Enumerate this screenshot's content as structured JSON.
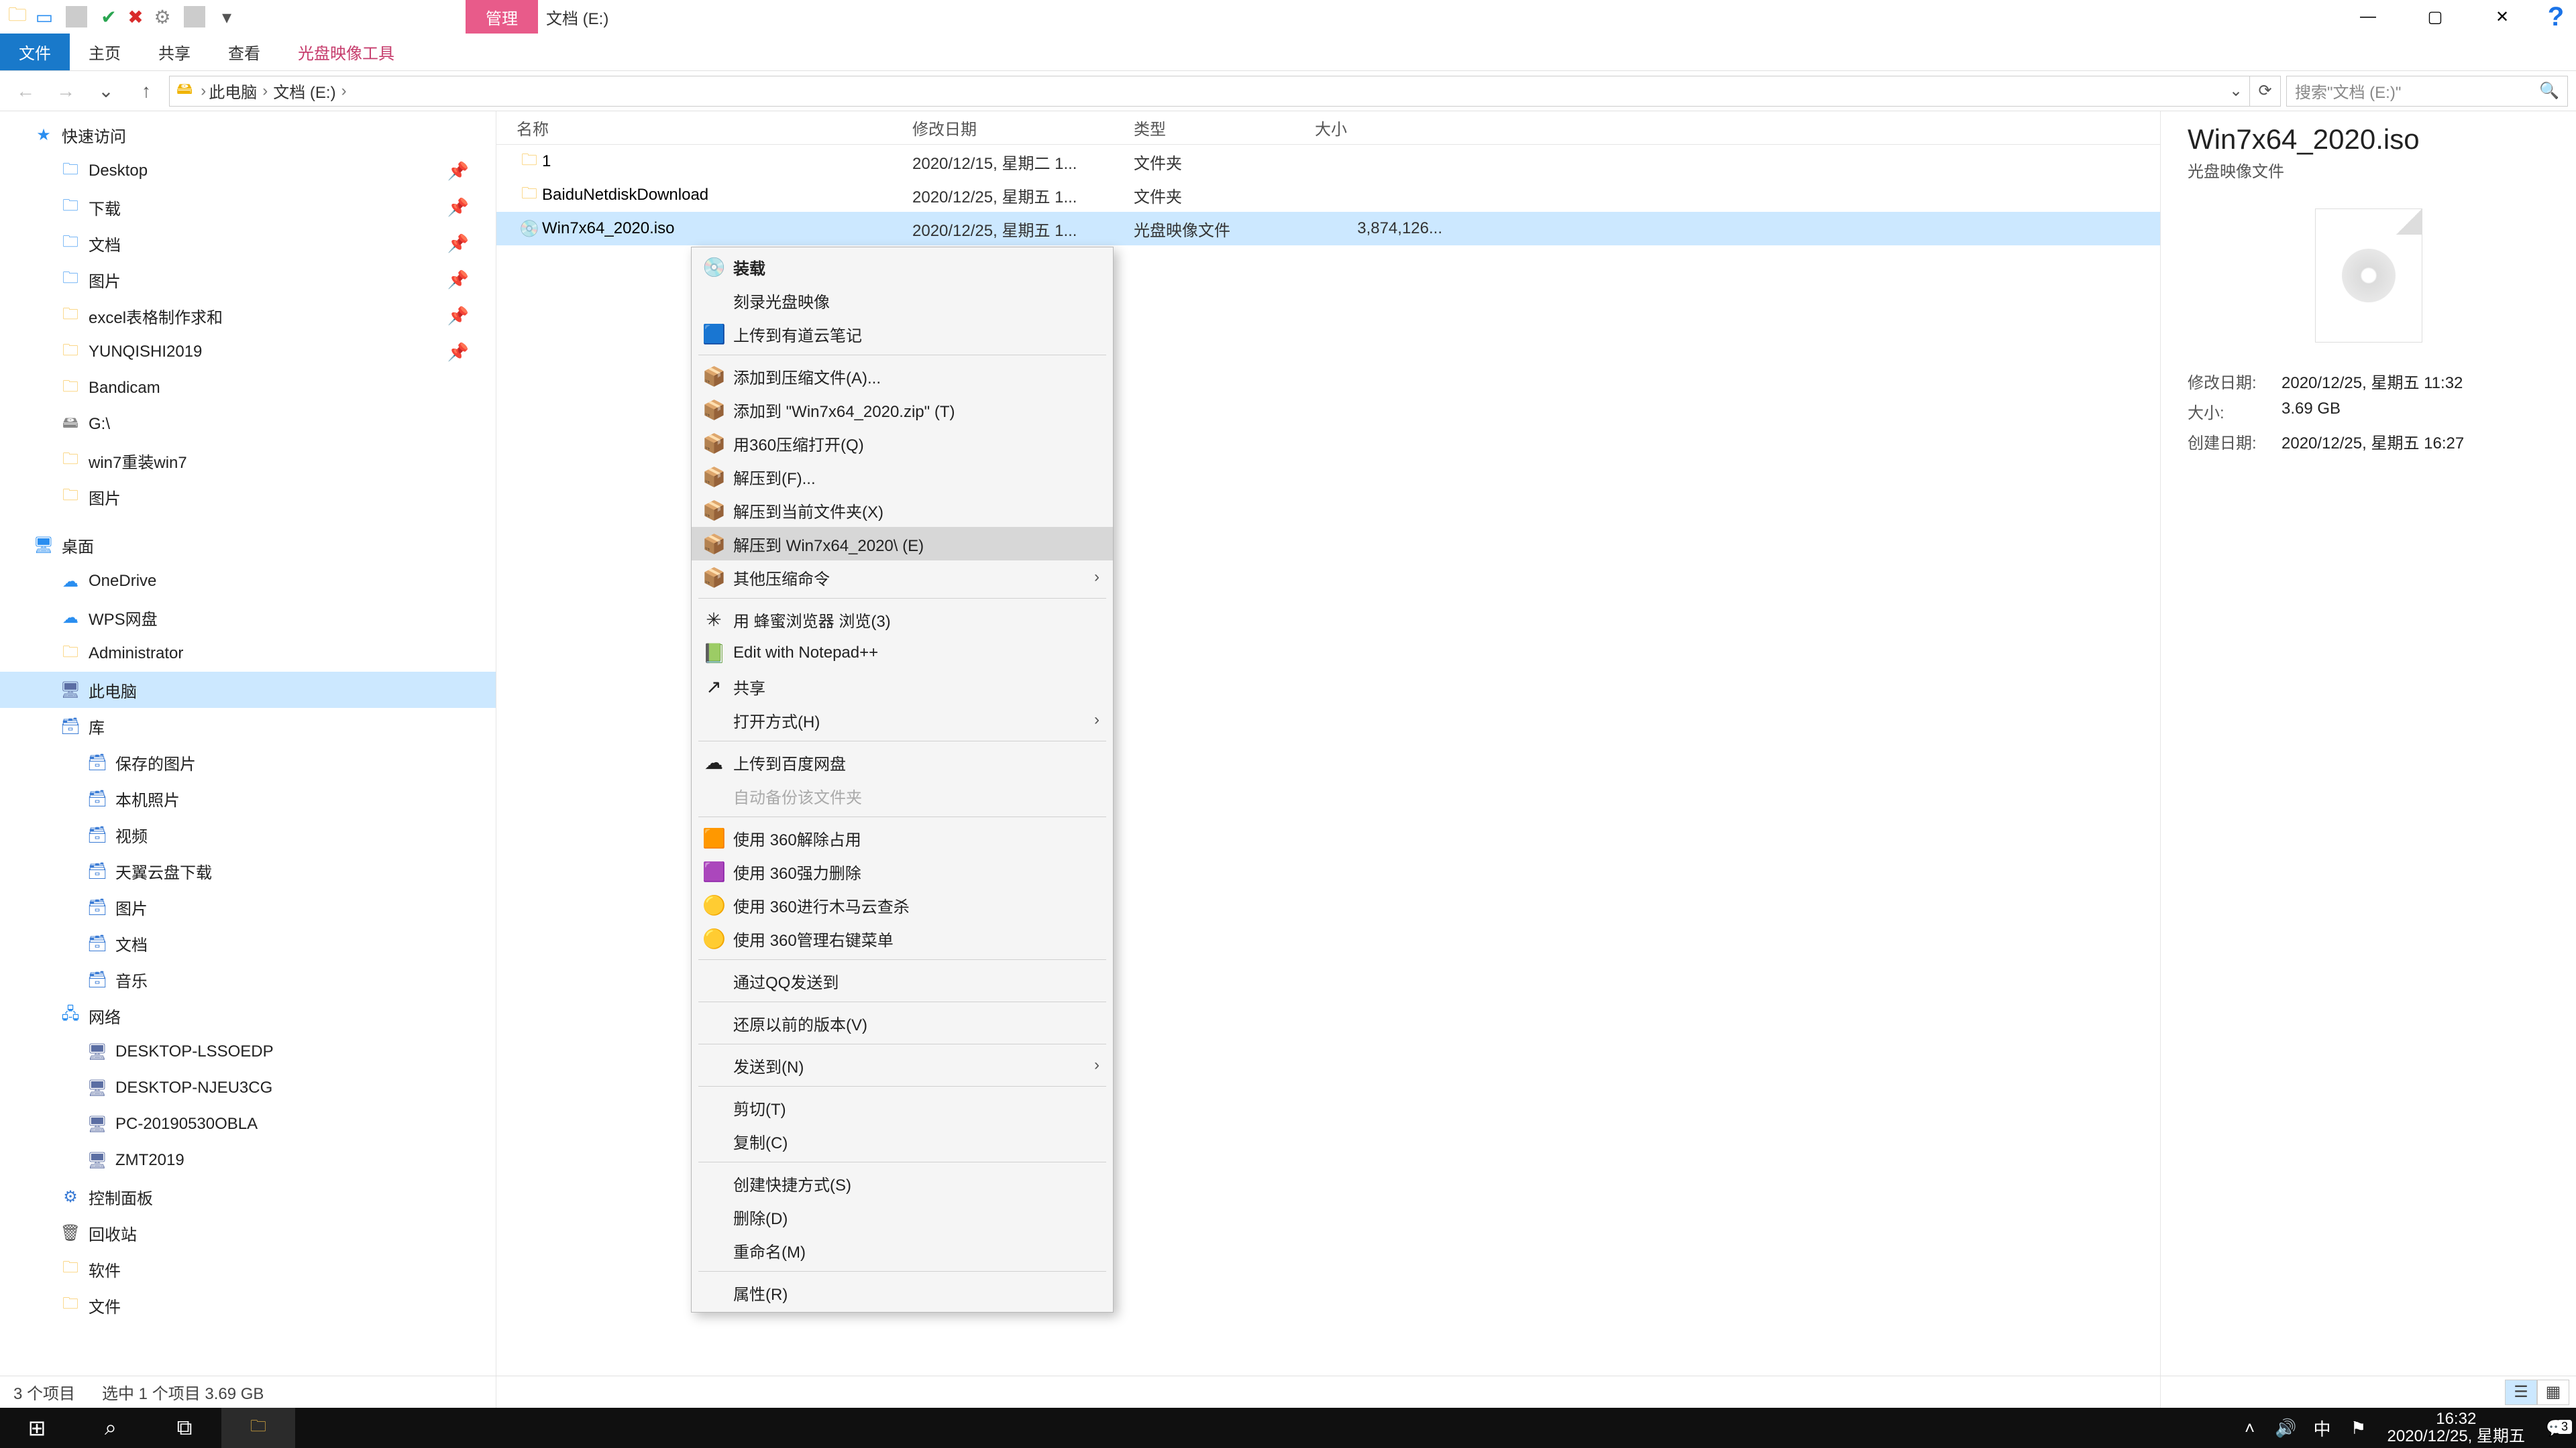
{
  "title": {
    "ribbon_section": "管理",
    "app_caption": "文档 (E:)"
  },
  "ribbon": {
    "file": "文件",
    "home": "主页",
    "share": "共享",
    "view": "查看",
    "disc_tools": "光盘映像工具"
  },
  "nav": {
    "breadcrumbs": [
      "此电脑",
      "文档 (E:)"
    ],
    "search_placeholder": "搜索\"文档 (E:)\""
  },
  "tree": {
    "quick_access": "快速访问",
    "items_qa": [
      {
        "label": "Desktop",
        "icon": "blue"
      },
      {
        "label": "下载",
        "icon": "blue"
      },
      {
        "label": "文档",
        "icon": "blue"
      },
      {
        "label": "图片",
        "icon": "blue"
      },
      {
        "label": "excel表格制作求和",
        "icon": "folder"
      },
      {
        "label": "YUNQISHI2019",
        "icon": "folder"
      },
      {
        "label": "Bandicam",
        "icon": "folder"
      },
      {
        "label": "G:\\",
        "icon": "drive"
      },
      {
        "label": "win7重装win7",
        "icon": "folder"
      },
      {
        "label": "图片",
        "icon": "folder"
      }
    ],
    "desktop": "桌面",
    "items_desktop": [
      {
        "label": "OneDrive",
        "icon": "blue"
      },
      {
        "label": "WPS网盘",
        "icon": "blue"
      },
      {
        "label": "Administrator",
        "icon": "folder"
      },
      {
        "label": "此电脑",
        "icon": "pc",
        "selected": true
      },
      {
        "label": "库",
        "icon": "lib"
      }
    ],
    "items_lib": [
      {
        "label": "保存的图片"
      },
      {
        "label": "本机照片"
      },
      {
        "label": "视频"
      },
      {
        "label": "天翼云盘下载"
      },
      {
        "label": "图片"
      },
      {
        "label": "文档"
      },
      {
        "label": "音乐"
      }
    ],
    "network": "网络",
    "items_net": [
      {
        "label": "DESKTOP-LSSOEDP"
      },
      {
        "label": "DESKTOP-NJEU3CG"
      },
      {
        "label": "PC-20190530OBLA"
      },
      {
        "label": "ZMT2019"
      }
    ],
    "control_panel": "控制面板",
    "recycle": "回收站",
    "software": "软件",
    "files": "文件"
  },
  "columns": {
    "name": "名称",
    "date": "修改日期",
    "type": "类型",
    "size": "大小"
  },
  "rows": [
    {
      "name": "1",
      "date": "2020/12/15, 星期二 1...",
      "type": "文件夹",
      "size": "",
      "icon": "folder"
    },
    {
      "name": "BaiduNetdiskDownload",
      "date": "2020/12/25, 星期五 1...",
      "type": "文件夹",
      "size": "",
      "icon": "folder"
    },
    {
      "name": "Win7x64_2020.iso",
      "date": "2020/12/25, 星期五 1...",
      "type": "光盘映像文件",
      "size": "3,874,126...",
      "icon": "disc",
      "selected": true
    }
  ],
  "details": {
    "filename": "Win7x64_2020.iso",
    "filetype": "光盘映像文件",
    "k_modified": "修改日期:",
    "v_modified": "2020/12/25, 星期五 11:32",
    "k_size": "大小:",
    "v_size": "3.69 GB",
    "k_created": "创建日期:",
    "v_created": "2020/12/25, 星期五 16:27"
  },
  "context_menu": [
    {
      "label": "装载",
      "bold": true,
      "icon": "💿"
    },
    {
      "label": "刻录光盘映像"
    },
    {
      "label": "上传到有道云笔记",
      "icon": "🟦"
    },
    {
      "sep": true
    },
    {
      "label": "添加到压缩文件(A)...",
      "icon": "📦"
    },
    {
      "label": "添加到 \"Win7x64_2020.zip\" (T)",
      "icon": "📦"
    },
    {
      "label": "用360压缩打开(Q)",
      "icon": "📦"
    },
    {
      "label": "解压到(F)...",
      "icon": "📦"
    },
    {
      "label": "解压到当前文件夹(X)",
      "icon": "📦"
    },
    {
      "label": "解压到 Win7x64_2020\\ (E)",
      "icon": "📦",
      "hover": true
    },
    {
      "label": "其他压缩命令",
      "icon": "📦",
      "submenu": true
    },
    {
      "sep": true
    },
    {
      "label": "用 蜂蜜浏览器 浏览(3)",
      "icon": "✳"
    },
    {
      "label": "Edit with Notepad++",
      "icon": "📗"
    },
    {
      "label": "共享",
      "icon": "↗"
    },
    {
      "label": "打开方式(H)",
      "submenu": true
    },
    {
      "sep": true
    },
    {
      "label": "上传到百度网盘",
      "icon": "☁"
    },
    {
      "label": "自动备份该文件夹",
      "disabled": true
    },
    {
      "sep": true
    },
    {
      "label": "使用 360解除占用",
      "icon": "🟧"
    },
    {
      "label": "使用 360强力删除",
      "icon": "🟪"
    },
    {
      "label": "使用 360进行木马云查杀",
      "icon": "🟡"
    },
    {
      "label": "使用 360管理右键菜单",
      "icon": "🟡"
    },
    {
      "sep": true
    },
    {
      "label": "通过QQ发送到"
    },
    {
      "sep": true
    },
    {
      "label": "还原以前的版本(V)"
    },
    {
      "sep": true
    },
    {
      "label": "发送到(N)",
      "submenu": true
    },
    {
      "sep": true
    },
    {
      "label": "剪切(T)"
    },
    {
      "label": "复制(C)"
    },
    {
      "sep": true
    },
    {
      "label": "创建快捷方式(S)"
    },
    {
      "label": "删除(D)"
    },
    {
      "label": "重命名(M)"
    },
    {
      "sep": true
    },
    {
      "label": "属性(R)"
    }
  ],
  "status": {
    "count": "3 个项目",
    "selection": "选中 1 个项目  3.69 GB"
  },
  "taskbar": {
    "time": "16:32",
    "date": "2020/12/25, 星期五",
    "ime": "中",
    "notif_count": "3"
  }
}
